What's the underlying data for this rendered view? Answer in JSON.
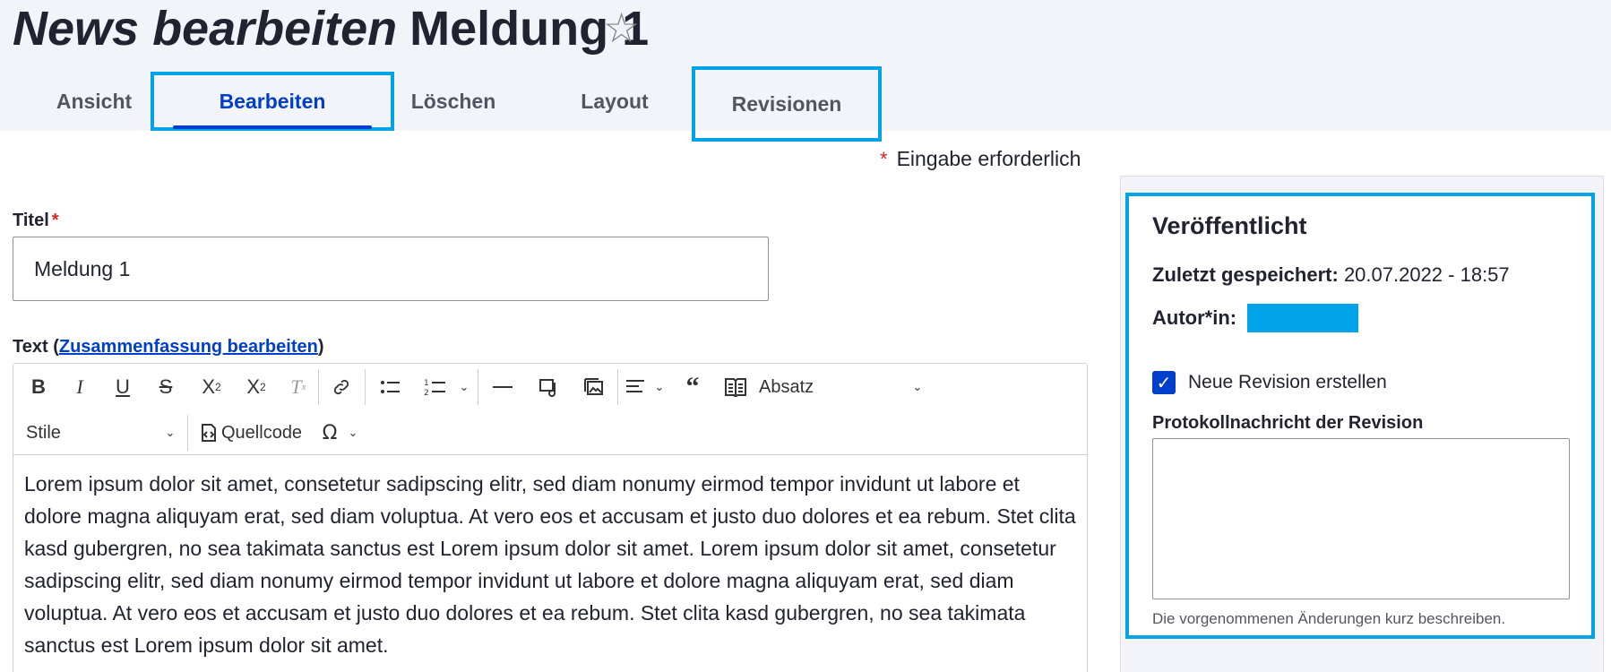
{
  "page": {
    "title_type": "News bearbeiten",
    "title_name": "Meldung 1",
    "star_icon": "☆"
  },
  "tabs": [
    {
      "label": "Ansicht",
      "active": false
    },
    {
      "label": "Bearbeiten",
      "active": true
    },
    {
      "label": "Löschen",
      "active": false
    },
    {
      "label": "Layout",
      "active": false
    },
    {
      "label": "Revisionen",
      "active": false
    }
  ],
  "form": {
    "required_marker": "*",
    "required_hint": "Eingabe erforderlich",
    "title_label": "Titel",
    "title_value": "Meldung 1",
    "text_label": "Text",
    "summary_link": "Zusammenfassung bearbeiten"
  },
  "editor": {
    "heading_select": "Absatz",
    "style_select": "Stile",
    "source_label": "Quellcode",
    "toolbar_icons": [
      "bold-icon",
      "italic-icon",
      "underline-icon",
      "strikethrough-icon",
      "superscript-icon",
      "subscript-icon",
      "remove-format-icon",
      "link-icon",
      "bulleted-list-icon",
      "numbered-list-icon",
      "horizontal-line-icon",
      "media-icon",
      "image-icon",
      "align-icon",
      "blockquote-icon",
      "table-of-contents-icon",
      "source-code-icon",
      "special-characters-icon"
    ],
    "content": "Lorem ipsum dolor sit amet, consetetur sadipscing elitr, sed diam nonumy eirmod tempor invidunt ut labore et dolore magna aliquyam erat, sed diam voluptua. At vero eos et accusam et justo duo dolores et ea rebum. Stet clita kasd gubergren, no sea takimata sanctus est Lorem ipsum dolor sit amet. Lorem ipsum dolor sit amet, consetetur sadipscing elitr, sed diam nonumy eirmod tempor invidunt ut labore et dolore magna aliquyam erat, sed diam voluptua. At vero eos et accusam et justo duo dolores et ea rebum. Stet clita kasd gubergren, no sea takimata sanctus est Lorem ipsum dolor sit amet."
  },
  "meta": {
    "status": "Veröffentlicht",
    "last_saved_label": "Zuletzt gespeichert:",
    "last_saved_value": "20.07.2022 - 18:57",
    "author_label": "Autor*in:",
    "new_revision_label": "Neue Revision erstellen",
    "new_revision_checked": true,
    "log_label": "Protokollnachricht der Revision",
    "log_value": "",
    "log_help": "Die vorgenommenen Änderungen kurz beschreiben."
  },
  "colors": {
    "accent": "#003ecc",
    "highlight": "#00a3e8",
    "required": "#dc2323",
    "header_bg": "#f3f4f9"
  }
}
